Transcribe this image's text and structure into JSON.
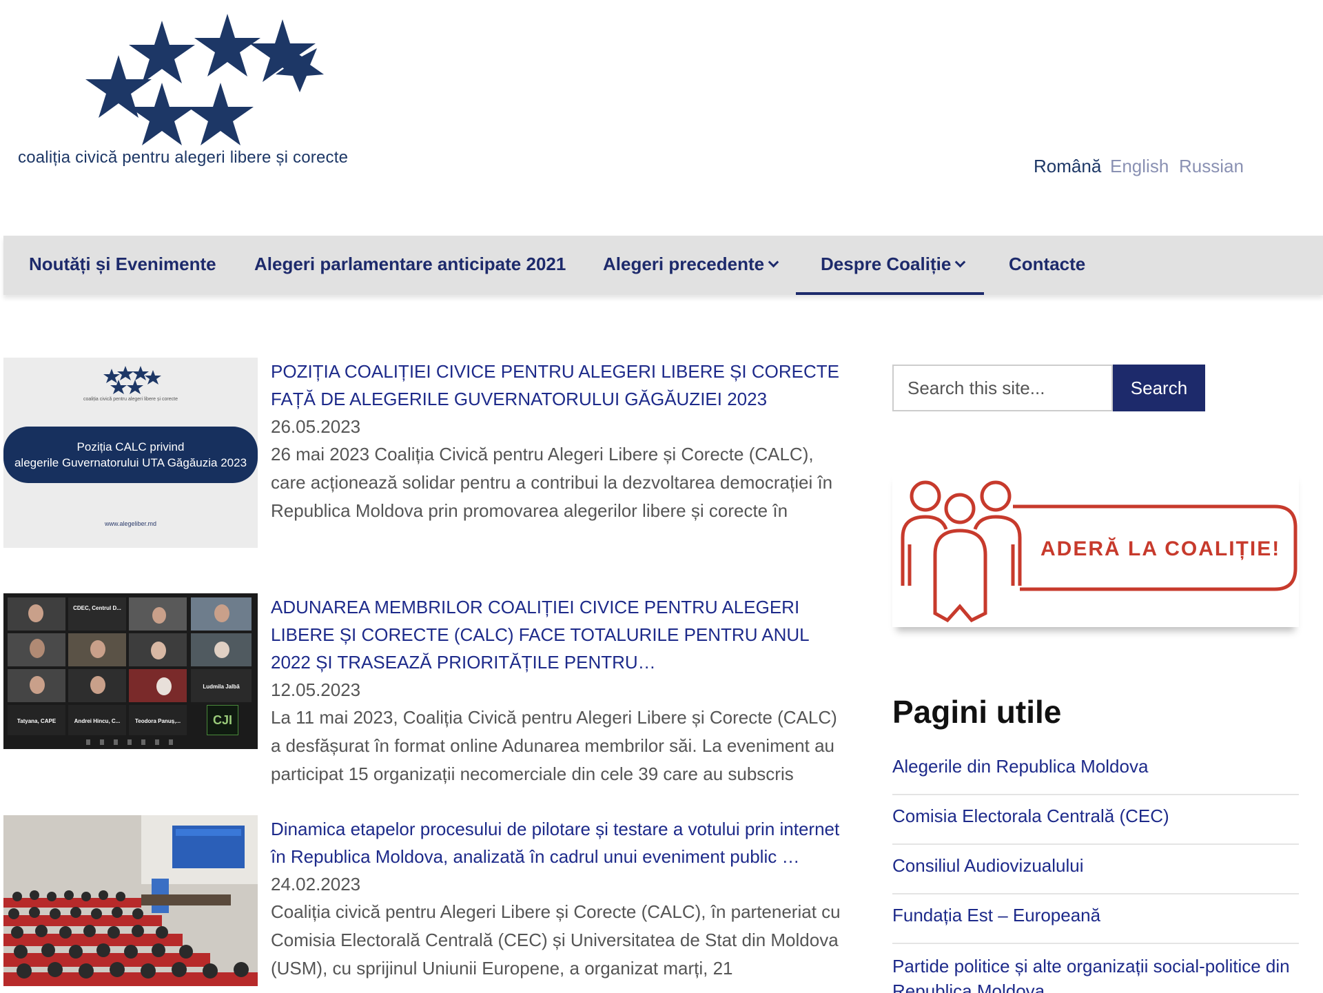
{
  "header": {
    "logo_text": "coaliția civică pentru alegeri libere și corecte",
    "languages": [
      {
        "label": "Română"
      },
      {
        "label": "English"
      },
      {
        "label": "Russian"
      }
    ]
  },
  "nav": {
    "items": [
      {
        "label": "Noutăți și Evenimente"
      },
      {
        "label": "Alegeri parlamentare anticipate 2021"
      },
      {
        "label": "Alegeri precedente"
      },
      {
        "label": "Despre Coaliție"
      },
      {
        "label": "Contacte"
      }
    ]
  },
  "articles": [
    {
      "title": "Poziția Coaliției Civice pentru Alegeri Libere și Corecte față de alegerile Guvernatorului Găgăuziei 2023",
      "date": "26.05.2023",
      "excerpt": "26 mai 2023 Coaliția Civică pentru Alegeri Libere și Corecte (CALC), care acționează solidar pentru a contribui la dezvoltarea democrației în Republica Moldova prin promovarea alegerilor libere și corecte în",
      "thumb": {
        "small_caption": "coaliția civică pentru alegeri libere și corecte",
        "banner_line1": "Poziția CALC privind",
        "banner_line2": "alegerile Guvernatorului UTA Găgăuzia 2023",
        "url": "www.alegeliber.md"
      }
    },
    {
      "title": "Adunarea membrilor Coaliției Civice pentru Alegeri Libere și Corecte (CALC) face totalurile pentru anul 2022 și trasează prioritățile pentru…",
      "date": "12.05.2023",
      "excerpt": "La 11 mai 2023, Coaliția Civică pentru Alegeri Libere și Corecte (CALC) a desfășurat în format online Adunarea membrilor săi. La eveniment au participat 15 organizații necomerciale din cele 39 care au subscris",
      "thumb": {
        "labels": [
          "CDEC, Centrul D...",
          "Ludmila Jalbă",
          "Tatyana, CAPE",
          "Andrei Hincu, C...",
          "Teodora Panuș,..."
        ],
        "logo": "CJI"
      }
    },
    {
      "title": "Dinamica etapelor procesului de pilotare și testare a votului prin internet în Republica Moldova, analizată în cadrul unui eveniment public …",
      "date": "24.02.2023",
      "excerpt": "Coaliția civică pentru Alegeri Libere și Corecte (CALC), în parteneriat cu Comisia Electorală Centrală (CEC) și Universitatea de Stat din Moldova (USM), cu sprijinul Uniunii Europene, a organizat marți, 21"
    }
  ],
  "sidebar": {
    "search": {
      "placeholder": "Search this site...",
      "button": "Search"
    },
    "join_banner": "ADERĂ LA COALIȚIE!",
    "widget_title": "Pagini utile",
    "links": [
      "Alegerile din Republica Moldova",
      "Comisia Electorala Centrală (CEC)",
      "Consiliul Audiovizualului",
      "Fundația Est – Europeană",
      "Partide politice și alte organizații social-politice din Republica Moldova"
    ]
  },
  "colors": {
    "brand_navy": "#1d2a6b",
    "link_blue": "#1d2a8a",
    "nav_bg": "#e1e1e1",
    "banner_red": "#c73a2c"
  }
}
